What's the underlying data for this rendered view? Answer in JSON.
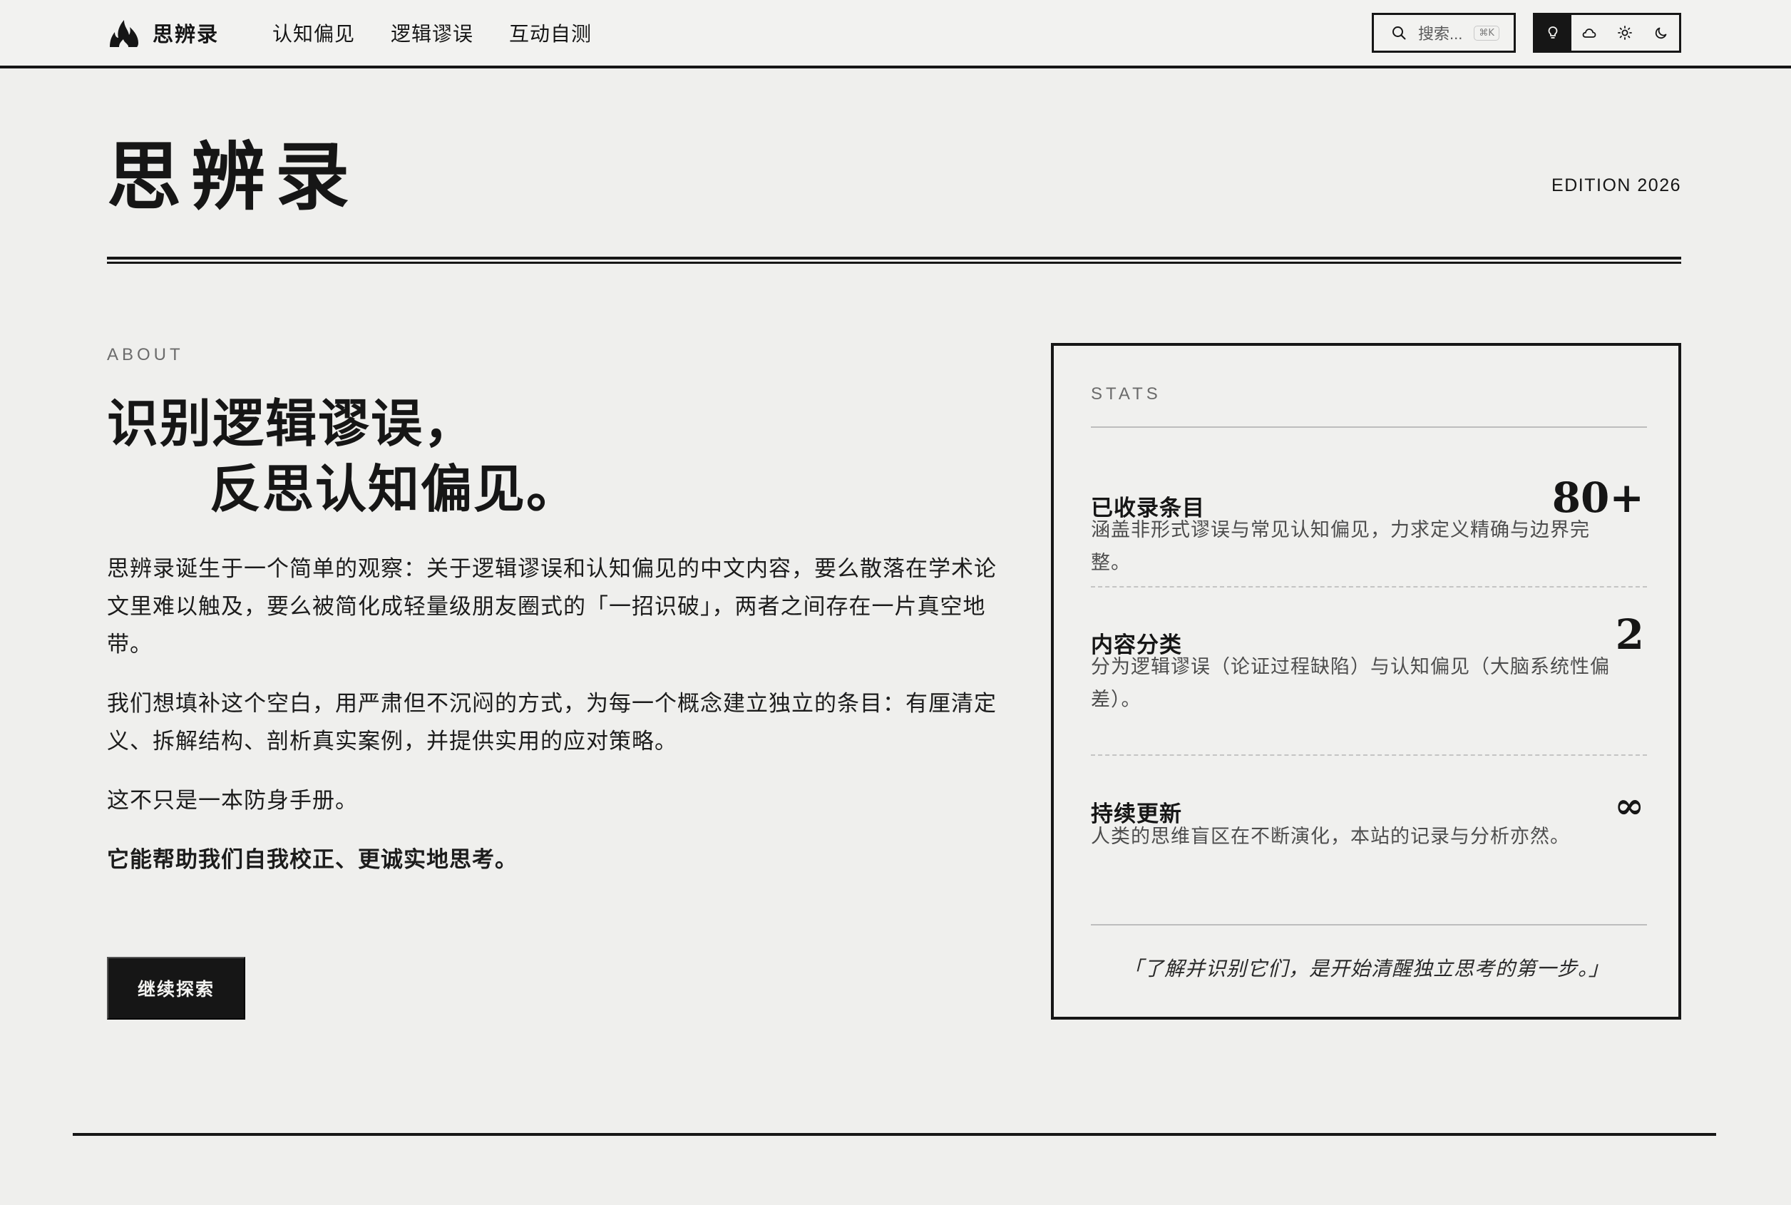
{
  "header": {
    "brand": "思辨录",
    "nav": [
      "认知偏见",
      "逻辑谬误",
      "互动自测"
    ],
    "search_placeholder": "搜索...",
    "search_shortcut": "⌘K",
    "theme_icons": [
      "bulb-icon",
      "cloud-icon",
      "sun-icon",
      "moon-icon"
    ]
  },
  "masthead": {
    "title": "思辨录",
    "edition": "EDITION 2026"
  },
  "about": {
    "eyebrow": "ABOUT",
    "headline_line1": "识别逻辑谬误，",
    "headline_line2": "反思认知偏见。",
    "paragraphs": [
      "思辨录诞生于一个简单的观察：关于逻辑谬误和认知偏见的中文内容，要么散落在学术论文里难以触及，要么被简化成轻量级朋友圈式的「一招识破」，两者之间存在一片真空地带。",
      "我们想填补这个空白，用严肃但不沉闷的方式，为每一个概念建立独立的条目：有厘清定义、拆解结构、剖析真实案例，并提供实用的应对策略。",
      "这不只是一本防身手册。",
      "它能帮助我们自我校正、更诚实地思考。"
    ],
    "cta": "继续探索"
  },
  "stats": {
    "eyebrow": "STATS",
    "items": [
      {
        "label": "已收录条目",
        "value": "80+",
        "desc": "涵盖非形式谬误与常见认知偏见，力求定义精确与边界完整。"
      },
      {
        "label": "内容分类",
        "value": "2",
        "desc": "分为逻辑谬误（论证过程缺陷）与认知偏见（大脑系统性偏差）。"
      },
      {
        "label": "持续更新",
        "value": "∞",
        "desc": "人类的思维盲区在不断演化，本站的记录与分析亦然。"
      }
    ],
    "quote": "「了解并识别它们，是开始清醒独立思考的第一步。」"
  },
  "colors": {
    "ink": "#161616",
    "paper": "#efefed",
    "muted": "#6b6b6b"
  }
}
